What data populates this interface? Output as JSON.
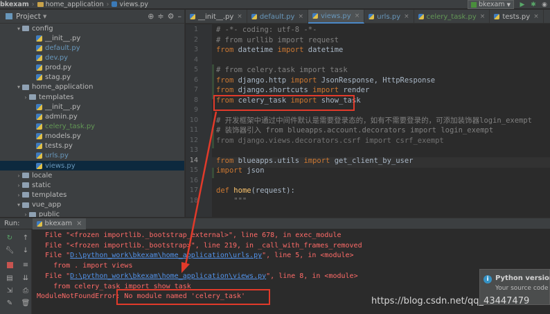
{
  "topbar": {
    "crumbs": [
      "bkexam",
      "home_application",
      "views.py"
    ],
    "run_config": "bkexam"
  },
  "project": {
    "title": "Project",
    "tree": [
      {
        "label": "config",
        "indent": 2,
        "arrow": "▾",
        "type": "folder",
        "color": "#bbbbbb"
      },
      {
        "label": "__init__.py",
        "indent": 4,
        "arrow": "",
        "type": "py",
        "color": "#bbbbbb"
      },
      {
        "label": "default.py",
        "indent": 4,
        "arrow": "",
        "type": "py",
        "color": "#6897bb"
      },
      {
        "label": "dev.py",
        "indent": 4,
        "arrow": "",
        "type": "py",
        "color": "#6897bb"
      },
      {
        "label": "prod.py",
        "indent": 4,
        "arrow": "",
        "type": "py",
        "color": "#bbbbbb"
      },
      {
        "label": "stag.py",
        "indent": 4,
        "arrow": "",
        "type": "py",
        "color": "#bbbbbb"
      },
      {
        "label": "home_application",
        "indent": 2,
        "arrow": "▾",
        "type": "folder",
        "color": "#bbbbbb"
      },
      {
        "label": "templates",
        "indent": 3,
        "arrow": "›",
        "type": "folder",
        "color": "#bbbbbb"
      },
      {
        "label": "__init__.py",
        "indent": 4,
        "arrow": "",
        "type": "py",
        "color": "#bbbbbb"
      },
      {
        "label": "admin.py",
        "indent": 4,
        "arrow": "",
        "type": "py",
        "color": "#bbbbbb"
      },
      {
        "label": "celery_task.py",
        "indent": 4,
        "arrow": "",
        "type": "py",
        "color": "#629755"
      },
      {
        "label": "models.py",
        "indent": 4,
        "arrow": "",
        "type": "py",
        "color": "#bbbbbb"
      },
      {
        "label": "tests.py",
        "indent": 4,
        "arrow": "",
        "type": "py",
        "color": "#bbbbbb"
      },
      {
        "label": "urls.py",
        "indent": 4,
        "arrow": "",
        "type": "py",
        "color": "#6897bb"
      },
      {
        "label": "views.py",
        "indent": 4,
        "arrow": "",
        "type": "py",
        "color": "#6897bb",
        "selected": true
      },
      {
        "label": "locale",
        "indent": 2,
        "arrow": "›",
        "type": "folder",
        "color": "#bbbbbb"
      },
      {
        "label": "static",
        "indent": 2,
        "arrow": "›",
        "type": "folder",
        "color": "#bbbbbb"
      },
      {
        "label": "templates",
        "indent": 2,
        "arrow": "›",
        "type": "folder",
        "color": "#bbbbbb"
      },
      {
        "label": "vue_app",
        "indent": 2,
        "arrow": "▾",
        "type": "folder",
        "color": "#bbbbbb"
      },
      {
        "label": "public",
        "indent": 3,
        "arrow": "›",
        "type": "folder",
        "color": "#bbbbbb"
      }
    ]
  },
  "tabs": [
    {
      "label": "__init__.py",
      "color": "#bbbbbb"
    },
    {
      "label": "default.py",
      "color": "#6897bb"
    },
    {
      "label": "views.py",
      "color": "#6897bb",
      "active": true
    },
    {
      "label": "urls.py",
      "color": "#6897bb"
    },
    {
      "label": "celery_task.py",
      "color": "#629755"
    },
    {
      "label": "tests.py",
      "color": "#bbbbbb"
    }
  ],
  "editor": {
    "line_numbers": [
      "1",
      "2",
      "3",
      "4",
      "5",
      "6",
      "7",
      "8",
      "9",
      "10",
      "11",
      "12",
      "13",
      "14",
      "15",
      "16",
      "17",
      "18"
    ],
    "current_line": "14",
    "lines": [
      [
        {
          "t": "# -*- coding: utf-8 -*-",
          "c": "cm"
        }
      ],
      [
        {
          "t": "# from urllib import request",
          "c": "cm"
        }
      ],
      [
        {
          "t": "from",
          "c": "kw"
        },
        {
          "t": " datetime ",
          "c": ""
        },
        {
          "t": "import",
          "c": "kw"
        },
        {
          "t": " datetime",
          "c": ""
        }
      ],
      [],
      [
        {
          "t": "# from celery.task import task",
          "c": "cm"
        }
      ],
      [
        {
          "t": "from",
          "c": "kw"
        },
        {
          "t": " django.http ",
          "c": ""
        },
        {
          "t": "import",
          "c": "kw"
        },
        {
          "t": " JsonResponse, HttpResponse",
          "c": ""
        }
      ],
      [
        {
          "t": "from",
          "c": "kw"
        },
        {
          "t": " django.shortcuts ",
          "c": ""
        },
        {
          "t": "import",
          "c": "kw"
        },
        {
          "t": " render",
          "c": ""
        }
      ],
      [
        {
          "t": "from",
          "c": "kw"
        },
        {
          "t": " celery_task ",
          "c": ""
        },
        {
          "t": "import",
          "c": "kw"
        },
        {
          "t": " show_task",
          "c": ""
        }
      ],
      [],
      [
        {
          "t": "# 开发框架中通过中间件默认是需要登录态的，如有不需要登录的，可添加装饰器login_exempt",
          "c": "cm"
        }
      ],
      [
        {
          "t": "# 装饰器引入 from blueapps.account.decorators import login_exempt",
          "c": "cm"
        }
      ],
      [
        {
          "t": "from django.views.decorators.csrf import csrf_exempt",
          "c": "dim"
        }
      ],
      [],
      [
        {
          "t": "from",
          "c": "kw"
        },
        {
          "t": " blueapps.utils ",
          "c": ""
        },
        {
          "t": "import",
          "c": "kw"
        },
        {
          "t": " get_client_by_user",
          "c": ""
        }
      ],
      [
        {
          "t": "import",
          "c": "kw"
        },
        {
          "t": " json",
          "c": ""
        }
      ],
      [],
      [
        {
          "t": "def",
          "c": "kw"
        },
        {
          "t": " ",
          "c": ""
        },
        {
          "t": "home",
          "c": "fn"
        },
        {
          "t": "(request):",
          "c": ""
        }
      ],
      [
        {
          "t": "    \"\"\"",
          "c": "cm"
        }
      ]
    ]
  },
  "run": {
    "label": "Run:",
    "tab": "bkexam"
  },
  "console": {
    "lines": [
      {
        "parts": [
          {
            "t": "  File \"<frozen importlib._bootstrap_external>\", line 678, in exec_module"
          }
        ]
      },
      {
        "parts": [
          {
            "t": "  File \"<frozen importlib._bootstrap>\", line 219, in _call_with_frames_removed"
          }
        ]
      },
      {
        "parts": [
          {
            "t": "  File \""
          },
          {
            "t": "D:\\python_work\\bkexam\\home_application\\urls.py",
            "link": true
          },
          {
            "t": "\", line 5, in <module>"
          }
        ]
      },
      {
        "parts": [
          {
            "t": "    from . import views"
          }
        ]
      },
      {
        "parts": [
          {
            "t": "  File \""
          },
          {
            "t": "D:\\python_work\\bkexam\\home_application\\views.py",
            "link": true
          },
          {
            "t": "\", line 8, in <module>"
          }
        ]
      },
      {
        "parts": [
          {
            "t": "    from celery_task import show_task"
          }
        ]
      },
      {
        "parts": [
          {
            "t": "ModuleNotFoundError: No module named 'celery_task'"
          }
        ]
      }
    ]
  },
  "notification": {
    "title": "Python versions c",
    "body": "Your source code c"
  },
  "watermark": "https://blog.csdn.net/qq_43447479",
  "colors": {
    "highlight_box": "#e23a2a",
    "arrow": "#e23a2a"
  }
}
